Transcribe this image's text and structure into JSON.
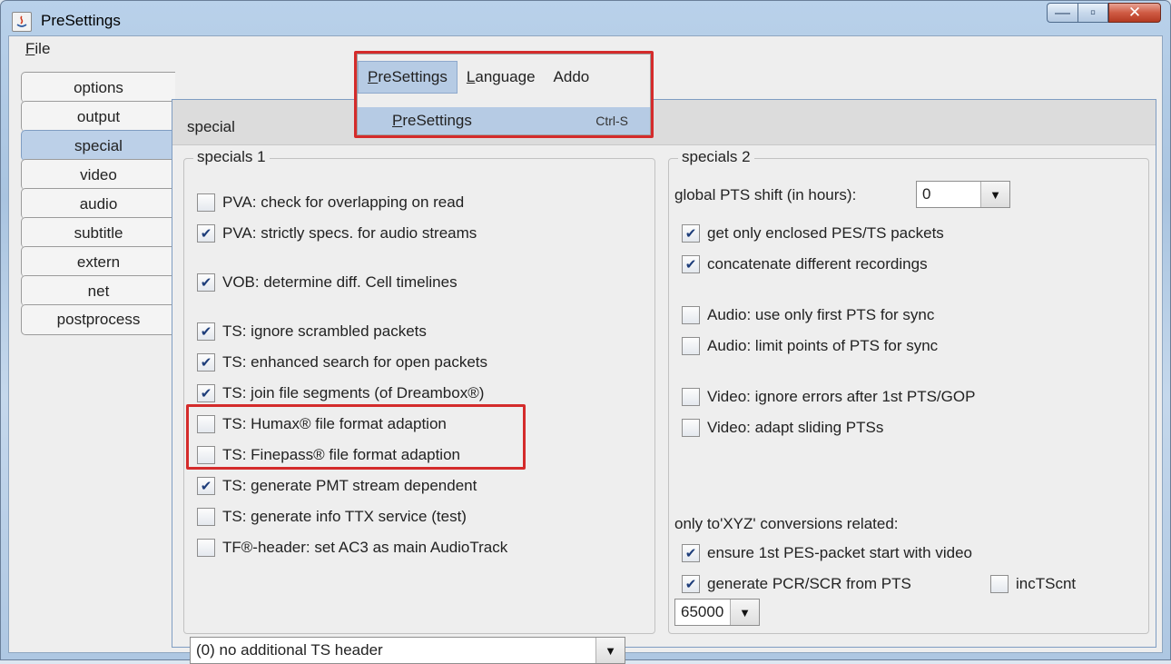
{
  "window": {
    "title": "PreSettings",
    "controls": {
      "minimize": "—",
      "maximize": "▫",
      "close": "✕"
    }
  },
  "menubar": {
    "file_mnemonic": "F",
    "file_rest": "ile"
  },
  "popup": {
    "menus": [
      {
        "mnemonic": "P",
        "rest": "reSettings"
      },
      {
        "mnemonic": "L",
        "rest": "anguage"
      },
      {
        "label": "Addo"
      }
    ],
    "item": {
      "mnemonic": "P",
      "rest": "reSettings",
      "accelerator": "Ctrl-S"
    }
  },
  "tabs": [
    "options",
    "output",
    "special",
    "video",
    "audio",
    "subtitle",
    "extern",
    "net",
    "postprocess"
  ],
  "selected_tab": "special",
  "panel": {
    "title": "special",
    "specials1": {
      "legend": "specials 1",
      "items": [
        {
          "label": "PVA: check for overlapping on read",
          "checked": false
        },
        {
          "label": "PVA: strictly specs. for audio streams",
          "checked": true
        },
        {
          "label": "VOB: determine diff. Cell timelines",
          "checked": true
        },
        {
          "label": "TS: ignore scrambled packets",
          "checked": true
        },
        {
          "label": "TS: enhanced search for open packets",
          "checked": true
        },
        {
          "label": "TS: join file segments (of Dreambox®)",
          "checked": true
        },
        {
          "label": "TS: Humax® file format adaption",
          "checked": false
        },
        {
          "label": "TS: Finepass® file format adaption",
          "checked": false
        },
        {
          "label": "TS: generate PMT stream dependent",
          "checked": true
        },
        {
          "label": "TS: generate info TTX service (test)",
          "checked": false
        },
        {
          "label": "TF®-header: set AC3 as main AudioTrack",
          "checked": false
        }
      ],
      "combo_value": "(0) no additional TS header"
    },
    "specials2": {
      "legend": "specials 2",
      "pts_shift_label": "global PTS shift (in hours):",
      "pts_shift_value": "0",
      "items": [
        {
          "label": "get only enclosed PES/TS packets",
          "checked": true
        },
        {
          "label": "concatenate different recordings",
          "checked": true
        },
        {
          "label": "Audio: use only first PTS for sync",
          "checked": false
        },
        {
          "label": "Audio: limit points of PTS for sync",
          "checked": false
        },
        {
          "label": "Video: ignore errors after 1st PTS/GOP",
          "checked": false
        },
        {
          "label": "Video: adapt sliding PTSs",
          "checked": false
        }
      ],
      "conversions_label": "only to'XYZ' conversions related:",
      "conv_items": [
        {
          "label": "ensure 1st PES-packet start with video",
          "checked": true
        },
        {
          "label": "generate PCR/SCR from PTS",
          "checked": true
        },
        {
          "label": "incTScnt",
          "checked": false
        }
      ],
      "combo_value": "65000"
    }
  },
  "icons": {
    "check": "✔",
    "dropdown": "▼"
  }
}
